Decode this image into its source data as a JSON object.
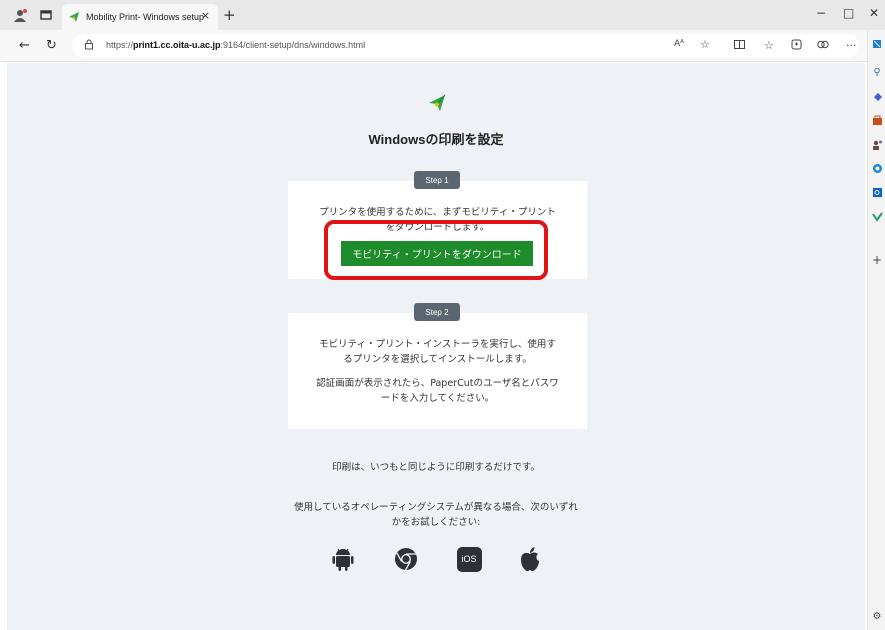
{
  "browser": {
    "tab_title": "Mobility Print- Windows setup",
    "tab_close": "×",
    "new_tab": "+",
    "window_controls": {
      "minimize": "−",
      "maximize": "□",
      "close": "✕"
    },
    "url_prefix": "https://",
    "url_host": "print1.cc.oita-u.ac.jp",
    "url_path": ":9164/client-setup/dns/windows.html",
    "read_aloud_label": "Aᴬ"
  },
  "page": {
    "title": "Windowsの印刷を設定",
    "step1": {
      "badge": "Step 1",
      "text_line1": "プリンタを使用するために、まずモビリティ・プリント",
      "text_line2": "をダウンロードします。",
      "download_button": "モビリティ・プリントをダウンロード"
    },
    "step2": {
      "badge": "Step 2",
      "text_line1": "モビリティ・プリント・インストーラを実行し、使用す",
      "text_line2": "るプリンタを選択してインストールします。",
      "text_line3": "認証画面が表示されたら、PaperCutのユーザ名とパスワ",
      "text_line4": "ードを入力してください。"
    },
    "footer_note": "印刷は、いつもと同じように印刷するだけです。",
    "other_os_line1": "使用しているオペレーティングシステムが異なる場合、次のいずれ",
    "other_os_line2": "かをお試しください:",
    "ios_label": "iOS"
  },
  "colors": {
    "accent_green": "#1e8c2b",
    "highlight_red": "#e01414",
    "badge_gray": "#5c6670",
    "page_bg": "#eef2f6"
  },
  "icons": [
    "profile-icon",
    "tab-actions-icon",
    "mobility-print-favicon",
    "back-icon",
    "refresh-icon",
    "lock-icon",
    "read-aloud-icon",
    "favorite-icon",
    "split-screen-icon",
    "favorites-icon",
    "collections-icon",
    "extensions-icon",
    "more-icon",
    "copilot-icon",
    "search-icon",
    "shopping-icon",
    "tools-icon",
    "people-icon",
    "games-icon",
    "outlook-icon",
    "drop-icon",
    "add-icon",
    "settings-icon",
    "android-icon",
    "chrome-icon",
    "ios-icon",
    "apple-icon"
  ]
}
